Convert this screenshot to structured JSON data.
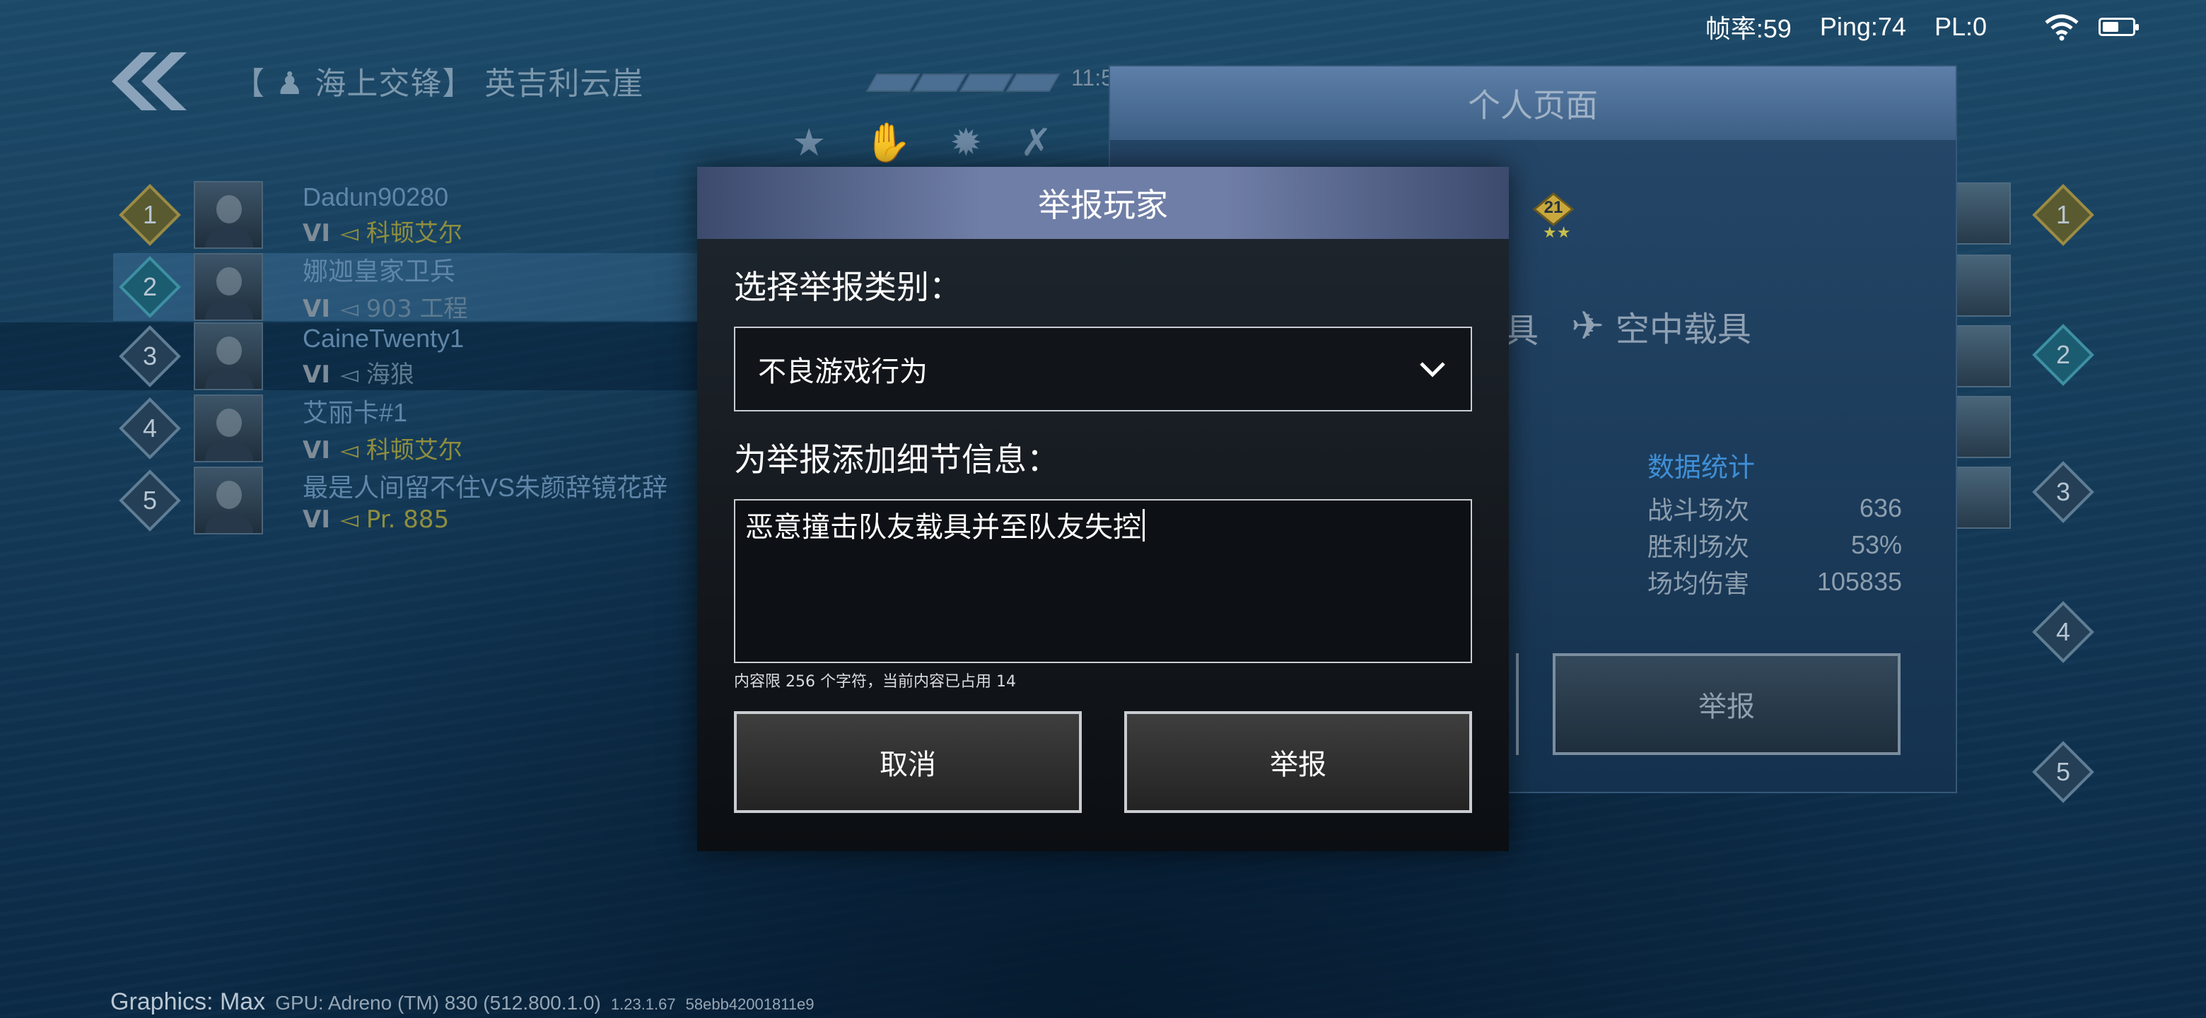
{
  "status_bar": {
    "fps": "帧率:59",
    "ping": "Ping:74",
    "pl": "PL:0"
  },
  "header": {
    "room_title": "【 ♟ 海上交锋】 英吉利云崖",
    "timer": "11:5"
  },
  "leaderboard": [
    {
      "rank": "1",
      "name": "Dadun90280",
      "tier": "VI",
      "ship": "◅ 科顿艾尔",
      "ship_color": "gold"
    },
    {
      "rank": "2",
      "name": "娜迦皇家卫兵",
      "tier": "VI",
      "ship": "◅ 903 工程",
      "ship_color": "grey"
    },
    {
      "rank": "3",
      "name": "CaineTwenty1",
      "tier": "VI",
      "ship": "◅ 海狼",
      "ship_color": "grey"
    },
    {
      "rank": "4",
      "name": "艾丽卡#1",
      "tier": "VI",
      "ship": "◅ 科顿艾尔",
      "ship_color": "gold"
    },
    {
      "rank": "5",
      "name": "最是人间留不住VS朱颜辞镜花辞",
      "tier": "VI",
      "ship": "◅ Pr. 885",
      "ship_color": "gold"
    }
  ],
  "right_ranks": [
    "1",
    "2",
    "3",
    "4",
    "5"
  ],
  "profile_panel": {
    "title": "个人页面",
    "badge_level": "21",
    "tab_partial": "具",
    "tab_air": "空中载具",
    "stats_title": "数据统计",
    "stats": [
      {
        "label": "战斗场次",
        "value": "636"
      },
      {
        "label": "胜利场次",
        "value": "53%"
      },
      {
        "label": "场均伤害",
        "value": "105835"
      }
    ],
    "report_button": "举报"
  },
  "dialog": {
    "title": "举报玩家",
    "category_label": "选择举报类别：",
    "category_value": "不良游戏行为",
    "details_label": "为举报添加细节信息：",
    "details_value": "恶意撞击队友载具并至队友失控",
    "hint": "内容限 256 个字符，当前内容已占用 14",
    "cancel_button": "取消",
    "submit_button": "举报"
  },
  "footer": {
    "graphics": "Graphics: Max",
    "gpu": "GPU: Adreno (TM) 830 (512.800.1.0)",
    "version": "1.23.1.67",
    "hash": "58ebb42001811e9"
  },
  "colors": {
    "accent_blue": "#3f8fd6",
    "dialog_header": "#6f7ea6",
    "ship_gold": "#8f8e3e"
  }
}
